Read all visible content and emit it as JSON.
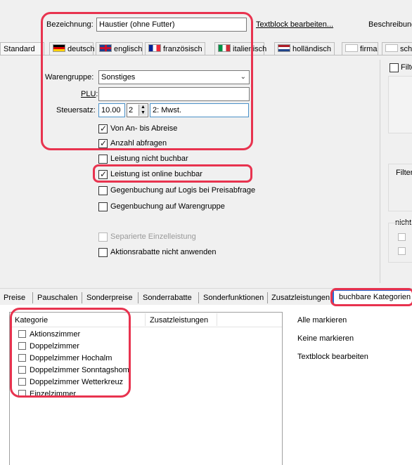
{
  "header": {
    "bezeichnung_label": "Bezeichnung:",
    "bezeichnung_value": "Haustier (ohne Futter)",
    "textblock_link": "Textblock bearbeiten...",
    "beschreibung_link": "Beschreibung"
  },
  "lang_tabs": [
    {
      "label": "Standard"
    },
    {
      "label": "deutsch"
    },
    {
      "label": "englisch"
    },
    {
      "label": "französisch"
    },
    {
      "label": "italienisch"
    },
    {
      "label": "holländisch"
    },
    {
      "label": "firma"
    },
    {
      "label": "schw"
    }
  ],
  "form": {
    "warengruppe_label": "Warengruppe:",
    "warengruppe_value": "Sonstiges",
    "plu_label": "PLU:",
    "plu_value": "",
    "steuersatz_label": "Steuersatz:",
    "steuersatz_value": "10.00",
    "steuer_code": "2",
    "steuer_text": "2: Mwst."
  },
  "options": [
    {
      "label": "Von An- bis Abreise",
      "checked": true
    },
    {
      "label": "Anzahl abfragen",
      "checked": true
    },
    {
      "label": "Leistung nicht buchbar",
      "checked": false
    },
    {
      "label": "Leistung ist online buchbar",
      "checked": true
    },
    {
      "label": "Gegenbuchung auf Logis bei Preisabfrage",
      "checked": false
    },
    {
      "label": "Gegenbuchung auf Warengruppe",
      "checked": false
    },
    {
      "label": "Separierte Einzelleistung",
      "checked": false,
      "disabled": true
    },
    {
      "label": "Aktionsrabatte nicht anwenden",
      "checked": false
    }
  ],
  "right_panel": {
    "filter_check_label": "Filte",
    "filter_group_label": "Filter",
    "nicht_group_label": "nicht"
  },
  "lower_tabs": [
    {
      "label": "Preise"
    },
    {
      "label": "Pauschalen"
    },
    {
      "label": "Sonderpreise"
    },
    {
      "label": "Sonderrabatte"
    },
    {
      "label": "Sonderfunktionen"
    },
    {
      "label": "Zusatzleistungen"
    },
    {
      "label": "buchbare Kategorien"
    }
  ],
  "kategorie_table": {
    "col_kategorie": "Kategorie",
    "col_zusatz": "Zusatzleistungen",
    "rows": [
      {
        "label": "Aktionszimmer",
        "checked": false
      },
      {
        "label": "Doppelzimmer",
        "checked": false
      },
      {
        "label": "Doppelzimmer Hochalm",
        "checked": false
      },
      {
        "label": "Doppelzimmer Sonntagshom",
        "checked": false
      },
      {
        "label": "Doppelzimmer Wetterkreuz",
        "checked": false
      },
      {
        "label": "Einzelzimmer",
        "checked": false
      }
    ]
  },
  "side_actions": {
    "alle": "Alle markieren",
    "keine": "Keine markieren",
    "textblock": "Textblock bearbeiten"
  },
  "colors": {
    "callout": "#e8334f",
    "active_tab_border": "#1f6fd6"
  }
}
